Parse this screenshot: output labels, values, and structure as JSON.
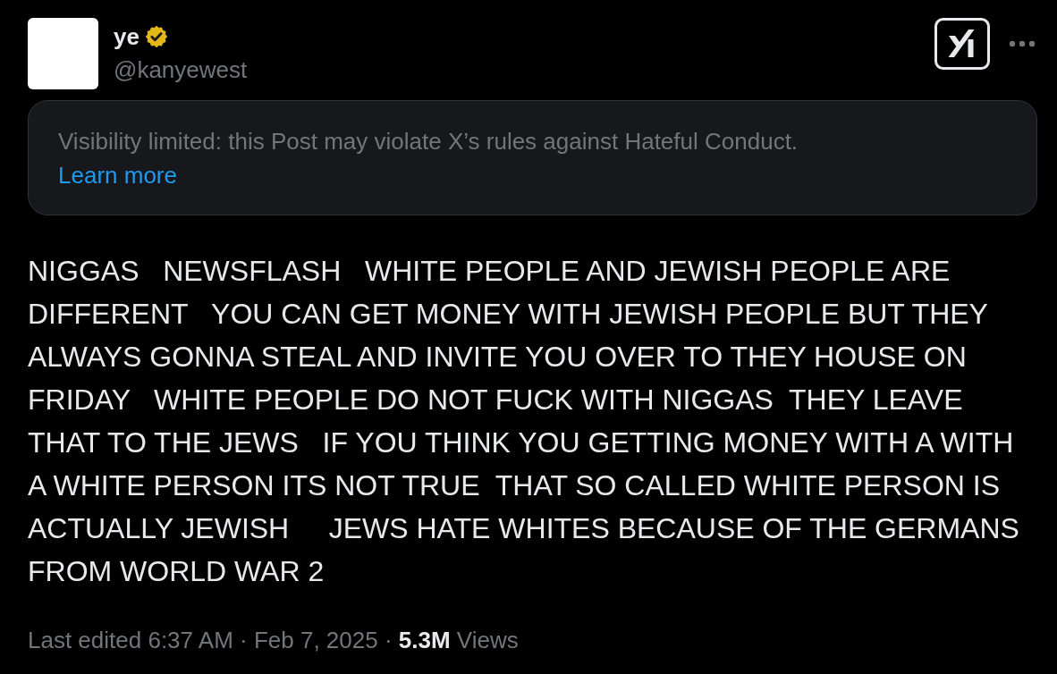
{
  "author": {
    "name": "ye",
    "verified": true,
    "handle": "@kanyewest"
  },
  "notice": {
    "text": "Visibility limited: this Post may violate X’s rules against Hateful Conduct.",
    "link": "Learn more"
  },
  "post": {
    "text": "NIGGAS   NEWSFLASH   WHITE PEOPLE AND JEWISH PEOPLE ARE DIFFERENT   YOU CAN GET MONEY WITH JEWISH PEOPLE BUT THEY ALWAYS GONNA STEAL AND INVITE YOU OVER TO THEY HOUSE ON FRIDAY   WHITE PEOPLE DO NOT FUCK WITH NIGGAS  THEY LEAVE THAT TO THE JEWS   IF YOU THINK YOU GETTING MONEY WITH A WITH A WHITE PERSON ITS NOT TRUE  THAT SO CALLED WHITE PERSON IS ACTUALLY JEWISH     JEWS HATE WHITES BECAUSE OF THE GERMANS FROM WORLD WAR 2"
  },
  "meta": {
    "text": "Last edited 6:37 AM · Feb 7, 2025 · **5.3M** Views"
  }
}
